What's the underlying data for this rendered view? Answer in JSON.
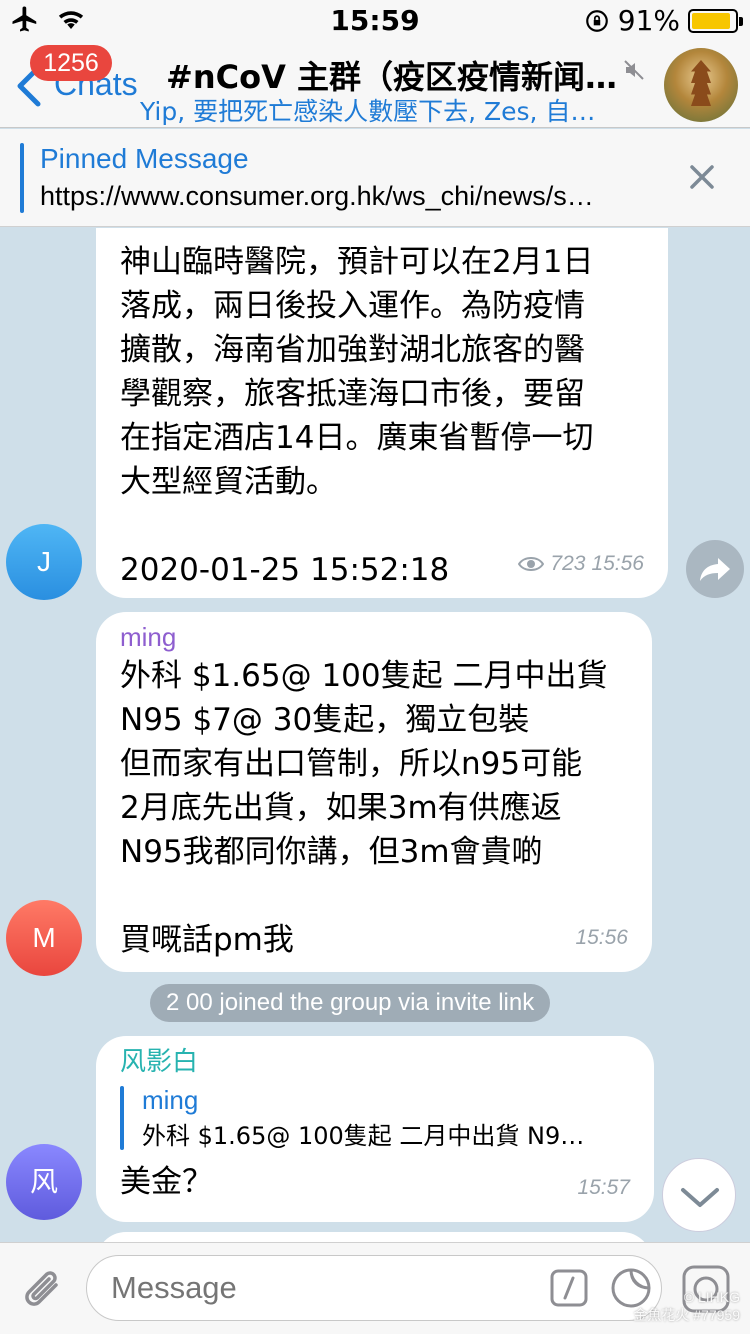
{
  "status_bar": {
    "time": "15:59",
    "battery": "91%",
    "battery_level": 0.91,
    "battery_color": "#f7c600"
  },
  "header": {
    "back_label": "Chats",
    "unread_count": "1256",
    "title": "#nCoV 主群（疫区疫情新闻…",
    "subtitle": "Yip, 要把死亡感染人數壓下去, Zes, 自…"
  },
  "pinned": {
    "title": "Pinned Message",
    "text": "https://www.consumer.org.hk/ws_chi/news/s…"
  },
  "messages": [
    {
      "avatar_letter": "J",
      "text": "神山臨時醫院，預計可以在2月1日\n落成，兩日後投入運作。為防疫情\n擴散，海南省加強對湖北旅客的醫\n學觀察，旅客抵達海口市後，要留\n在指定酒店14日。廣東省暫停一切\n大型經貿活動。\n\n2020-01-25 15:52:18",
      "views": "723",
      "time": "15:56"
    },
    {
      "avatar_letter": "M",
      "sender": "ming",
      "text": "外科 $1.65@ 100隻起 二月中出貨\nN95 $7@ 30隻起，獨立包裝\n但而家有出口管制，所以n95可能\n2月底先出貨，如果3m有供應返\nN95我都同你講，但3m會貴啲\n\n買嘅話pm我",
      "time": "15:56"
    },
    {
      "avatar_letter": "风",
      "sender": "风影白",
      "reply_name": "ming",
      "reply_text": "外科 $1.65@ 100隻起 二月中出貨 N9…",
      "text": "美金？",
      "time": "15:57"
    }
  ],
  "service_message": "2 00 joined the group via invite link",
  "input": {
    "placeholder": "Message"
  },
  "watermark": "© LIHKG\n金魚花火 #77959",
  "colors": {
    "accent": "#1f7bd6",
    "badge": "#e9463e",
    "sender_ming": "#8e5ecf",
    "sender_feng": "#27b3b0"
  }
}
